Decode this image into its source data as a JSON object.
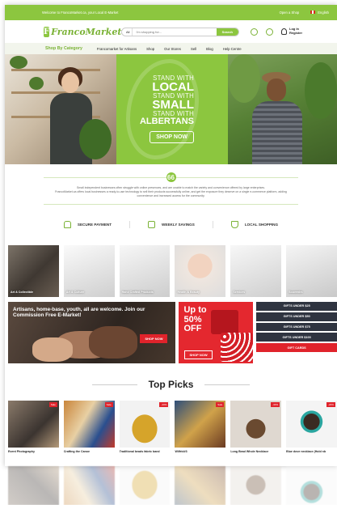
{
  "topbar": {
    "welcome": "Welcome to FrancoMarket.ca, your Local E-Market",
    "open_shop": "Open a Shop",
    "language": "English"
  },
  "header": {
    "logo_mark": "F",
    "logo_text": "FrancoMarket",
    "search_category": "All",
    "search_placeholder": "I'm shopping for...",
    "search_button": "Search",
    "login_line1": "Log In",
    "login_line2": "Register"
  },
  "nav": {
    "category": "Shop By Category",
    "items": [
      "Francomarket for Artisans",
      "Shop",
      "Our Stores",
      "Sell",
      "Blog",
      "Help Centre"
    ]
  },
  "hero": {
    "line1": "STAND WITH",
    "big1": "LOCAL",
    "line2": "STAND WITH",
    "big2": "SMALL",
    "line3": "STAND WITH",
    "big3": "ALBERTANS",
    "button": "SHOP NOW"
  },
  "about": {
    "quote_icon": "66",
    "line1": "Small independent businesses often struggle with online presences, and are unable to match the variety and convenience offered by large enterprises.",
    "line2": "FrancoMarket.ca offers local businesses a ready-to-use technology to sell their products successfully online, and get the exposure they deserve on a single e-commerce platform, adding convenience and increased access for the community."
  },
  "features": [
    "SECURE PAYMENT",
    "WEEKLY SAVINGS",
    "LOCAL SHOPPING"
  ],
  "categories": [
    "Art & Collectible",
    "Art & Culture",
    "Hand Crafted Products",
    "Health & Beauty",
    "Services",
    "Souvenirs"
  ],
  "promo": {
    "main_text": "Artisans, home-base, youth, all are welcome. Join our Commission Free E-Market!",
    "main_button": "SHOP NOW",
    "sale_line1": "Up to",
    "sale_line2": "50%",
    "sale_line3": "OFF",
    "sale_button": "SHOP NOW",
    "gift_links": [
      "GIFTS UNDER $25",
      "GIFTS UNDER $50",
      "GIFTS UNDER $75",
      "GIFTS UNDER $100",
      "GIFT CARDS"
    ]
  },
  "picks": {
    "title": "Top Picks",
    "items": [
      {
        "name": "Event Photography",
        "badge": "Sale"
      },
      {
        "name": "Crafting the Canoe",
        "badge": "Sale"
      },
      {
        "name": "Traditional beads fabric band",
        "badge": "-20%"
      },
      {
        "name": "Wilfrid#3",
        "badge": "Sale"
      },
      {
        "name": "Long Bead Whole Necklace",
        "badge": "-30%"
      },
      {
        "name": "Blue dove necklace (Hold nb",
        "badge": "-20%"
      }
    ]
  },
  "colors": {
    "brand_green": "#8cc63f",
    "accent_red": "#e0232b",
    "dark_navy": "#2f3440"
  }
}
